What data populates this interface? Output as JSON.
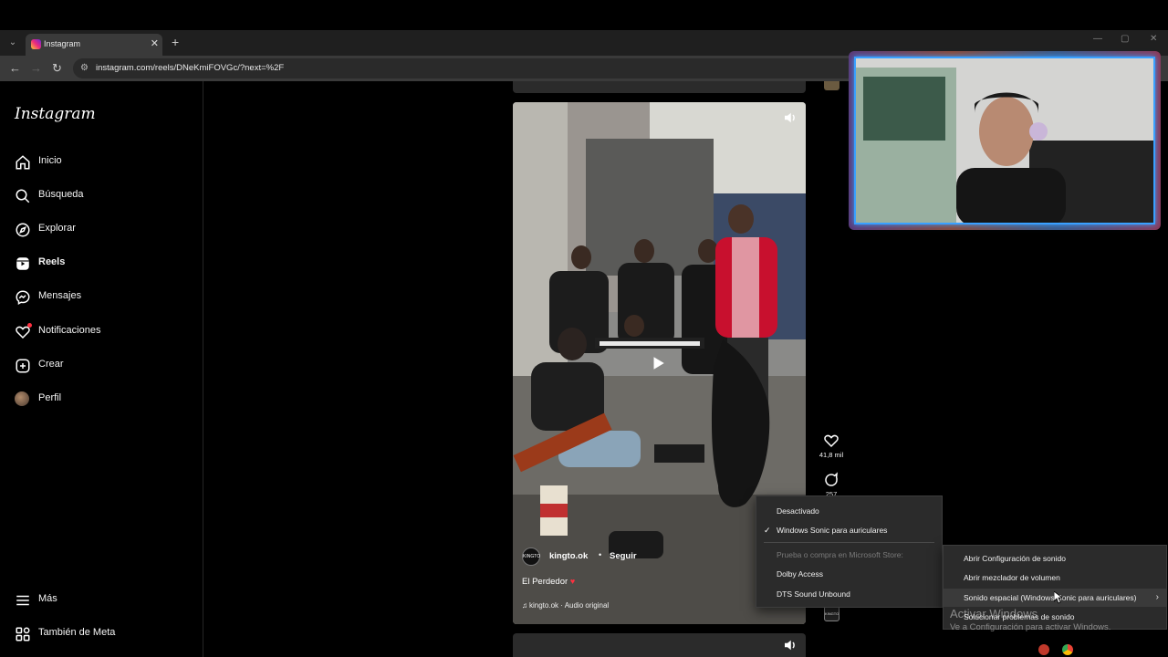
{
  "browser": {
    "tab_title": "Instagram",
    "tab_close": "✕",
    "new_tab": "+",
    "url": "instagram.com/reels/DNeKmiFOVGc/?next=%2F"
  },
  "sidebar": {
    "logo": "Instagram",
    "items": [
      {
        "label": "Inicio",
        "icon": "home-icon"
      },
      {
        "label": "Búsqueda",
        "icon": "search-icon"
      },
      {
        "label": "Explorar",
        "icon": "compass-icon"
      },
      {
        "label": "Reels",
        "icon": "reels-icon",
        "active": true
      },
      {
        "label": "Mensajes",
        "icon": "messenger-icon"
      },
      {
        "label": "Notificaciones",
        "icon": "heart-icon"
      },
      {
        "label": "Crear",
        "icon": "plus-square-icon"
      },
      {
        "label": "Perfil",
        "icon": "avatar"
      }
    ],
    "more": "Más",
    "meta": "También de Meta"
  },
  "reel": {
    "username": "kingto.ok",
    "separator": "•",
    "follow": "Seguir",
    "caption": "El Perdedor",
    "caption_emoji": "♥",
    "audio_icon": "♫",
    "audio": "kingto.ok · Audio original",
    "avatar_text": "KINGTO"
  },
  "actions": {
    "likes": "41,8 mil",
    "comments": "257"
  },
  "spatial_menu": {
    "items": [
      {
        "label": "Desactivado",
        "checked": false,
        "disabled": false
      },
      {
        "label": "Windows Sonic para auriculares",
        "checked": true,
        "disabled": false
      },
      {
        "label": "Prueba o compra en Microsoft Store:",
        "checked": false,
        "disabled": true
      },
      {
        "label": "Dolby Access",
        "checked": false,
        "disabled": false
      },
      {
        "label": "DTS Sound Unbound",
        "checked": false,
        "disabled": false
      }
    ],
    "check": "✓"
  },
  "sound_menu": {
    "items": [
      {
        "label": "Abrir Configuración de sonido"
      },
      {
        "label": "Abrir mezclador de volumen"
      },
      {
        "label": "Sonido espacial (Windows Sonic para auriculares)",
        "submenu": true
      },
      {
        "label": "Solucionar problemas de sonido"
      }
    ],
    "arrow": "›"
  },
  "watermark": {
    "title": "Activar Windows",
    "subtitle": "Ve a Configuración para activar Windows."
  },
  "colors": {
    "accent_red": "#ff3040",
    "webcam_border": "#3aa0ff",
    "jacket_red": "#c8102e"
  }
}
